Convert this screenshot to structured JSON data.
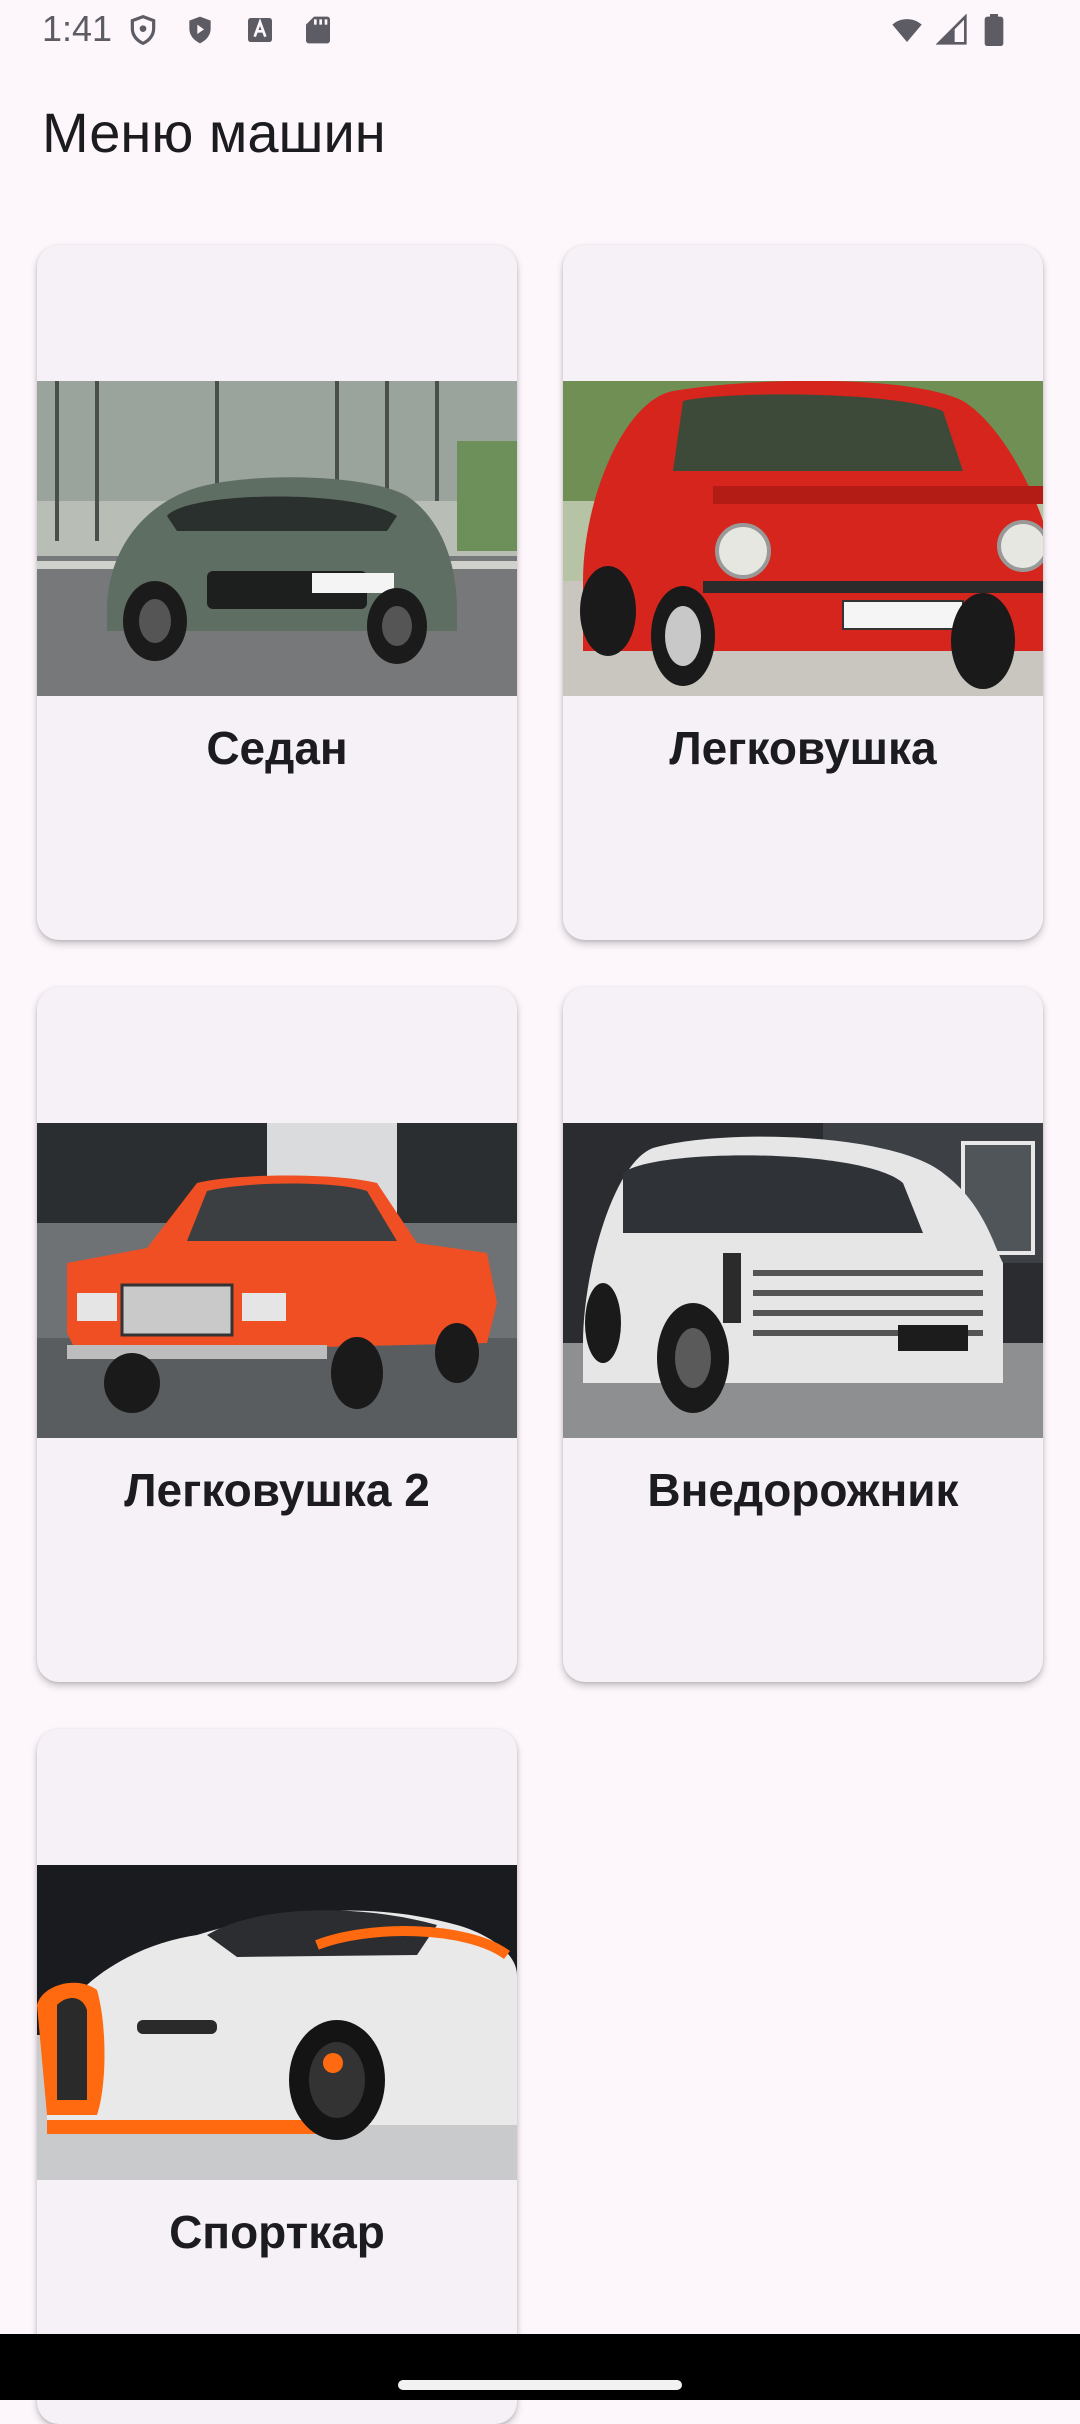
{
  "status_bar": {
    "time": "1:41",
    "icons": [
      "shield-icon",
      "play-protect-icon",
      "text-icon",
      "sd-card-icon",
      "wifi-icon",
      "signal-icon",
      "battery-icon"
    ]
  },
  "header": {
    "title": "Меню машин"
  },
  "cards": [
    {
      "label": "Седан",
      "image": "green-crossover-photo",
      "accent": "#5e6e63"
    },
    {
      "label": "Легковушка",
      "image": "red-zaporozhets-photo",
      "accent": "#d6251c"
    },
    {
      "label": "Легковушка 2",
      "image": "orange-lada-photo",
      "accent": "#f04f24"
    },
    {
      "label": "Внедорожник",
      "image": "white-suv-photo",
      "accent": "#e6e6e6"
    },
    {
      "label": "Спорткар",
      "image": "white-orange-hypercar-photo",
      "accent": "#ff6a10"
    }
  ],
  "colors": {
    "background": "#fdf7fc",
    "card": "#f5f1f7",
    "nav_bar": "#000000"
  }
}
